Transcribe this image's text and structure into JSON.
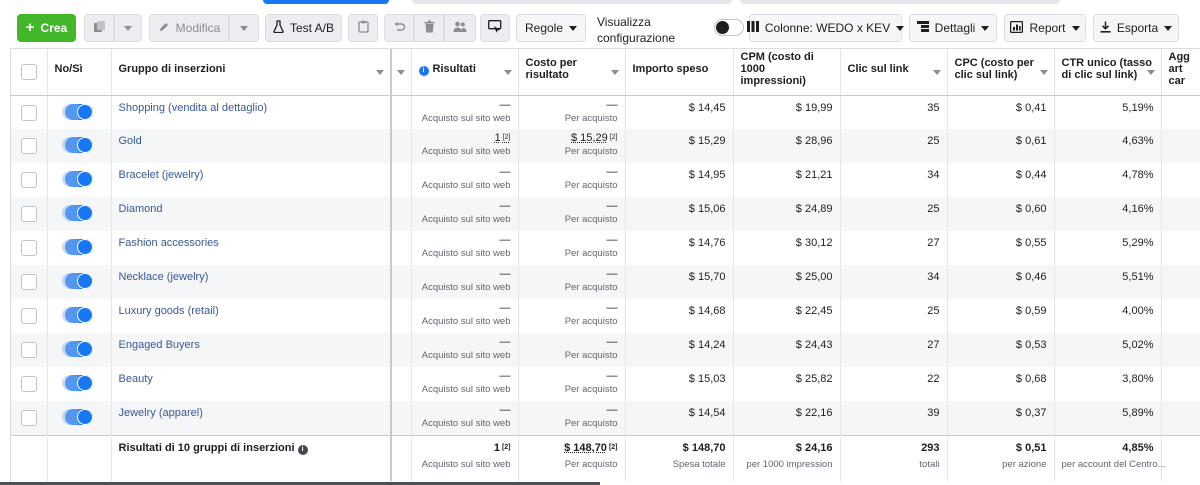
{
  "toolbar": {
    "create_label": "Crea",
    "edit_label": "Modifica",
    "abtest_label": "Test A/B",
    "rules_label": "Regole",
    "view_config_line1": "Visualizza",
    "view_config_line2": "configurazione",
    "columns_label": "Colonne: WEDO x KEV",
    "details_label": "Dettagli",
    "report_label": "Report",
    "export_label": "Esporta"
  },
  "colors": {
    "accent": "#1877f2",
    "create": "#42b72a",
    "link": "#385898"
  },
  "table": {
    "headers": {
      "onoff": "No/Sì",
      "adset": "Gruppo di inserzioni",
      "results": "Risultati",
      "cost_per_result": "Costo per risultato",
      "spend": "Importo speso",
      "cpm": "CPM (costo di 1000 impressioni)",
      "link_clicks": "Clic sul link",
      "cpc": "CPC (costo per clic sul link)",
      "ctr": "CTR unico (tasso di clic sul link)",
      "next": "Agg art car"
    },
    "rows": [
      {
        "name": "Shopping (vendita al dettaglio)",
        "results": "—",
        "results_sub": "Acquisto sul sito web",
        "cost": "—",
        "cost_sub": "Per acquisto",
        "spend": "$ 14,45",
        "cpm": "$ 19,99",
        "clicks": "35",
        "cpc": "$ 0,41",
        "ctr": "5,19%"
      },
      {
        "name": "Gold",
        "results": "1",
        "results_sup": "[2]",
        "results_sub": "Acquisto sul sito web",
        "cost": "$ 15,29",
        "cost_sup": "[2]",
        "cost_sub": "Per acquisto",
        "spend": "$ 15,29",
        "cpm": "$ 28,96",
        "clicks": "25",
        "cpc": "$ 0,61",
        "ctr": "4,63%"
      },
      {
        "name": "Bracelet (jewelry)",
        "results": "—",
        "results_sub": "Acquisto sul sito web",
        "cost": "—",
        "cost_sub": "Per acquisto",
        "spend": "$ 14,95",
        "cpm": "$ 21,21",
        "clicks": "34",
        "cpc": "$ 0,44",
        "ctr": "4,78%"
      },
      {
        "name": "Diamond",
        "results": "—",
        "results_sub": "Acquisto sul sito web",
        "cost": "—",
        "cost_sub": "Per acquisto",
        "spend": "$ 15,06",
        "cpm": "$ 24,89",
        "clicks": "25",
        "cpc": "$ 0,60",
        "ctr": "4,16%"
      },
      {
        "name": "Fashion accessories",
        "results": "—",
        "results_sub": "Acquisto sul sito web",
        "cost": "—",
        "cost_sub": "Per acquisto",
        "spend": "$ 14,76",
        "cpm": "$ 30,12",
        "clicks": "27",
        "cpc": "$ 0,55",
        "ctr": "5,29%"
      },
      {
        "name": "Necklace (jewelry)",
        "results": "—",
        "results_sub": "Acquisto sul sito web",
        "cost": "—",
        "cost_sub": "Per acquisto",
        "spend": "$ 15,70",
        "cpm": "$ 25,00",
        "clicks": "34",
        "cpc": "$ 0,46",
        "ctr": "5,51%"
      },
      {
        "name": "Luxury goods (retail)",
        "results": "—",
        "results_sub": "Acquisto sul sito web",
        "cost": "—",
        "cost_sub": "Per acquisto",
        "spend": "$ 14,68",
        "cpm": "$ 22,45",
        "clicks": "25",
        "cpc": "$ 0,59",
        "ctr": "4,00%"
      },
      {
        "name": "Engaged Buyers",
        "results": "—",
        "results_sub": "Acquisto sul sito web",
        "cost": "—",
        "cost_sub": "Per acquisto",
        "spend": "$ 14,24",
        "cpm": "$ 24,43",
        "clicks": "27",
        "cpc": "$ 0,53",
        "ctr": "5,02%"
      },
      {
        "name": "Beauty",
        "results": "—",
        "results_sub": "Acquisto sul sito web",
        "cost": "—",
        "cost_sub": "Per acquisto",
        "spend": "$ 15,03",
        "cpm": "$ 25,82",
        "clicks": "22",
        "cpc": "$ 0,68",
        "ctr": "3,80%"
      },
      {
        "name": "Jewelry (apparel)",
        "results": "—",
        "results_sub": "Acquisto sul sito web",
        "cost": "—",
        "cost_sub": "Per acquisto",
        "spend": "$ 14,54",
        "cpm": "$ 22,16",
        "clicks": "39",
        "cpc": "$ 0,37",
        "ctr": "5,89%"
      }
    ],
    "totals": {
      "label": "Risultati di 10 gruppi di inserzioni",
      "results": "1",
      "results_sup": "[2]",
      "results_sub": "Acquisto sul sito web",
      "cost": "$ 148,70",
      "cost_sup": "[2]",
      "cost_sub": "Per acquisto",
      "spend": "$ 148,70",
      "spend_sub": "Spesa totale",
      "cpm": "$ 24,16",
      "cpm_sub": "per 1000 impression",
      "clicks": "293",
      "clicks_sub": "totali",
      "cpc": "$ 0,51",
      "cpc_sub": "per azione",
      "ctr": "4,85%",
      "ctr_sub": "per account del Centro..."
    }
  }
}
